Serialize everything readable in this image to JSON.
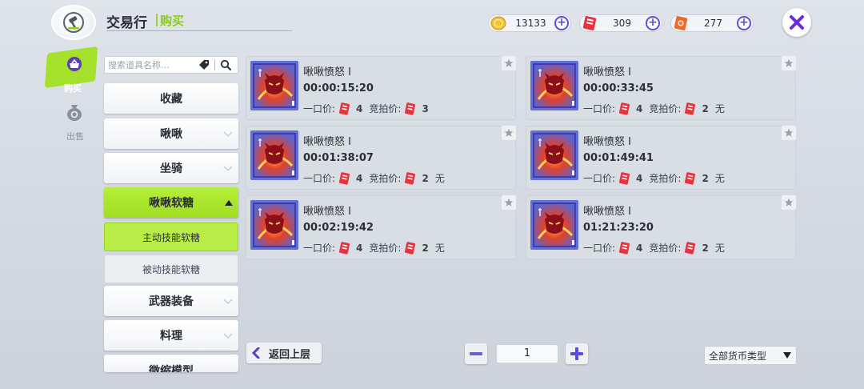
{
  "header": {
    "title": "交易行",
    "subtitle": "购买",
    "icons": {
      "logo": "gavel-icon"
    }
  },
  "currencies": [
    {
      "name": "gold-coin",
      "value": "13133",
      "icon": "gold-coin-icon",
      "color": "#f2c232"
    },
    {
      "name": "red-ticket",
      "value": "309",
      "icon": "red-ticket-icon",
      "color": "#e8333f"
    },
    {
      "name": "orange-ticket",
      "value": "277",
      "icon": "orange-ticket-icon",
      "color": "#ef6a2a"
    }
  ],
  "rail": {
    "buy_label": "购买",
    "sell_label": "出售"
  },
  "search": {
    "placeholder": "搜索道具名称..."
  },
  "categories": [
    {
      "label": "收藏"
    },
    {
      "label": "啾啾"
    },
    {
      "label": "坐骑"
    },
    {
      "label": "啾啾软糖"
    },
    {
      "label": "武器装备"
    },
    {
      "label": "料理"
    },
    {
      "label": "微缩模型"
    }
  ],
  "subcategories": [
    {
      "label": "主动技能软糖"
    },
    {
      "label": "被动技能软糖"
    }
  ],
  "listings": [
    {
      "name": "啾啾愤怒 I",
      "time": "00:00:15:20",
      "buyout_label": "一口价:",
      "buyout": "4",
      "bid_label": "竞拍价:",
      "bid": "3",
      "note": ""
    },
    {
      "name": "啾啾愤怒 I",
      "time": "00:00:33:45",
      "buyout_label": "一口价:",
      "buyout": "4",
      "bid_label": "竞拍价:",
      "bid": "2",
      "note": "无"
    },
    {
      "name": "啾啾愤怒 I",
      "time": "00:01:38:07",
      "buyout_label": "一口价:",
      "buyout": "4",
      "bid_label": "竞拍价:",
      "bid": "2",
      "note": "无"
    },
    {
      "name": "啾啾愤怒 I",
      "time": "00:01:49:41",
      "buyout_label": "一口价:",
      "buyout": "4",
      "bid_label": "竞拍价:",
      "bid": "2",
      "note": "无"
    },
    {
      "name": "啾啾愤怒 I",
      "time": "00:02:19:42",
      "buyout_label": "一口价:",
      "buyout": "4",
      "bid_label": "竞拍价:",
      "bid": "2",
      "note": "无"
    },
    {
      "name": "啾啾愤怒 I",
      "time": "01:21:23:20",
      "buyout_label": "一口价:",
      "buyout": "4",
      "bid_label": "竞拍价:",
      "bid": "2",
      "note": "无"
    }
  ],
  "footer": {
    "back_label": "返回上层",
    "page": "1",
    "currency_filter": "全部货币类型"
  },
  "colors": {
    "accent_green": "#a5e12a",
    "close_purple": "#6c2bd9",
    "plus_blue": "#5a4ce0"
  }
}
